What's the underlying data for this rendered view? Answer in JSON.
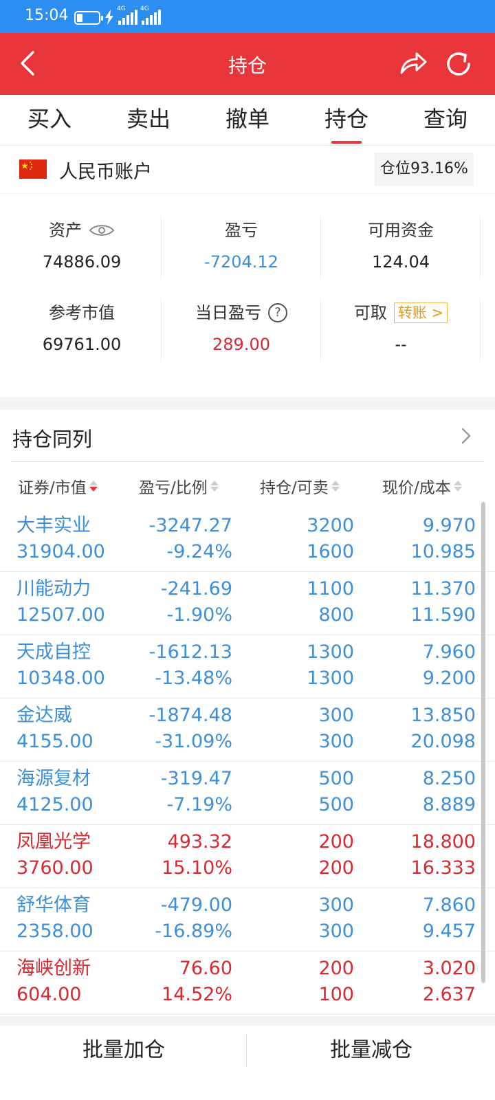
{
  "status_bar": {
    "time": "15:04",
    "network_1": "4G",
    "network_2": "4G"
  },
  "header": {
    "title": "持仓"
  },
  "tabs": [
    {
      "label": "买入"
    },
    {
      "label": "卖出"
    },
    {
      "label": "撤单"
    },
    {
      "label": "持仓",
      "active": true
    },
    {
      "label": "查询"
    }
  ],
  "account": {
    "name": "人民币账户",
    "position_ratio": "仓位93.16%"
  },
  "summary": {
    "assets_label": "资产",
    "assets_value": "74886.09",
    "pl_label": "盈亏",
    "pl_value": "-7204.12",
    "available_label": "可用资金",
    "available_value": "124.04",
    "market_value_label": "参考市值",
    "market_value": "69761.00",
    "daily_pl_label": "当日盈亏",
    "daily_pl_value": "289.00",
    "withdrawable_label": "可取",
    "transfer_label": "转账 >",
    "withdrawable_value": "--"
  },
  "section": {
    "title": "持仓同列"
  },
  "table": {
    "headers": [
      "证券/市值",
      "盈亏/比例",
      "持仓/可卖",
      "现价/成本"
    ],
    "rows": [
      {
        "name": "大丰实业",
        "market_value": "31904.00",
        "pl": "-3247.27",
        "pl_ratio": "-9.24%",
        "position": "3200",
        "sellable": "1600",
        "price": "9.970",
        "cost": "10.985",
        "trend": "down"
      },
      {
        "name": "川能动力",
        "market_value": "12507.00",
        "pl": "-241.69",
        "pl_ratio": "-1.90%",
        "position": "1100",
        "sellable": "800",
        "price": "11.370",
        "cost": "11.590",
        "trend": "down"
      },
      {
        "name": "天成自控",
        "market_value": "10348.00",
        "pl": "-1612.13",
        "pl_ratio": "-13.48%",
        "position": "1300",
        "sellable": "1300",
        "price": "7.960",
        "cost": "9.200",
        "trend": "down"
      },
      {
        "name": "金达威",
        "market_value": "4155.00",
        "pl": "-1874.48",
        "pl_ratio": "-31.09%",
        "position": "300",
        "sellable": "300",
        "price": "13.850",
        "cost": "20.098",
        "trend": "down"
      },
      {
        "name": "海源复材",
        "market_value": "4125.00",
        "pl": "-319.47",
        "pl_ratio": "-7.19%",
        "position": "500",
        "sellable": "500",
        "price": "8.250",
        "cost": "8.889",
        "trend": "down"
      },
      {
        "name": "凤凰光学",
        "market_value": "3760.00",
        "pl": "493.32",
        "pl_ratio": "15.10%",
        "position": "200",
        "sellable": "200",
        "price": "18.800",
        "cost": "16.333",
        "trend": "up"
      },
      {
        "name": "舒华体育",
        "market_value": "2358.00",
        "pl": "-479.00",
        "pl_ratio": "-16.89%",
        "position": "300",
        "sellable": "300",
        "price": "7.860",
        "cost": "9.457",
        "trend": "down"
      },
      {
        "name": "海峡创新",
        "market_value": "604.00",
        "pl": "76.60",
        "pl_ratio": "14.52%",
        "position": "200",
        "sellable": "100",
        "price": "3.020",
        "cost": "2.637",
        "trend": "up"
      }
    ]
  },
  "bottom": {
    "add_label": "批量加仓",
    "reduce_label": "批量减仓"
  },
  "colors": {
    "header": "#e8353a",
    "status_bar": "#2c8ef0",
    "gain": "#d9282f",
    "loss": "#3c8fd8"
  }
}
